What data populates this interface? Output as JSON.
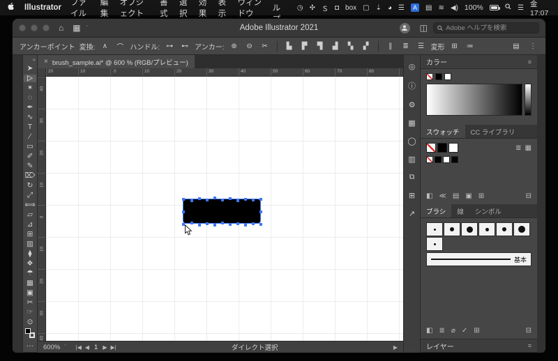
{
  "icons": {
    "close": "×",
    "chevron_small": "ˇ",
    "menu": "≡",
    "double_chevron": "»",
    "home": "⌂",
    "grid": "▦",
    "panel": "◫",
    "ellipsis": "…",
    "list_view": "≣",
    "grid_view": "▦",
    "play": "▶",
    "first": "|◀",
    "prev": "◀",
    "next": "▶",
    "last": "▶|",
    "control_center": "☰"
  },
  "menubar": {
    "app_name": "Illustrator",
    "menus": [
      "ファイル",
      "編集",
      "オブジェクト",
      "書式",
      "選択",
      "効果",
      "表示",
      "ウィンドウ",
      "ヘルプ"
    ],
    "status_icons": [
      "◷",
      "✣",
      "Ｓ",
      "◘",
      "box",
      "▢",
      "⇣",
      "◕",
      "☰"
    ],
    "input_badge": "A",
    "status_icons2": [
      "▤",
      "≋",
      "◀)"
    ],
    "battery_label": "100%",
    "clock": "金 17:07"
  },
  "titlebar": {
    "title": "Adobe Illustrator 2021",
    "search_placeholder": "Adobe ヘルプを検索"
  },
  "controlbar": {
    "anchor_point_label": "アンカーポイント",
    "convert_label": "変換:",
    "convert_icons": [
      "∧",
      "⌒"
    ],
    "handles_label": "ハンドル:",
    "handle_icons": [
      "⊶",
      "⊷"
    ],
    "anchors_label": "アンカー:",
    "anchor_icons": [
      "⊕",
      "⊖",
      "✂"
    ],
    "align_icons": [
      "▙",
      "▛",
      "▜",
      "▟",
      "▚",
      "▞"
    ],
    "dist_icons": [
      "∥",
      "≣",
      "☰"
    ],
    "transform_label": "変形",
    "extra_icons": [
      "⊞",
      "≔"
    ],
    "right_icons": [
      "▤",
      "⋮"
    ]
  },
  "doc": {
    "tab_title": "brush_sample.ai* @ 600 % (RGB/プレビュー)",
    "ruler_h": [
      "20",
      "10",
      "0",
      "10",
      "20",
      "30",
      "40",
      "50",
      "60",
      "70",
      "80"
    ],
    "ruler_v": [
      "40",
      "30",
      "20",
      "10",
      "0",
      "10",
      "20",
      "30",
      "40"
    ],
    "zoom": "600%",
    "page": "1",
    "status_tool": "ダイレクト選択"
  },
  "tools": [
    "➤",
    "▷",
    "✶",
    "◌",
    "✒",
    "∿",
    "T",
    "∕",
    "▭",
    "✐",
    "✎",
    "⌦",
    "↻",
    "⤢",
    "⟺",
    "▱",
    "⊿",
    "⊞",
    "▥",
    "⧫",
    "❖",
    "☂",
    "▦",
    "▣",
    "✂",
    "☞",
    "⊙"
  ],
  "icon_strip": [
    "◎",
    "ⓘ",
    "⚙",
    "▦",
    "◯",
    "▥",
    "⧉",
    "⊞",
    "↗"
  ],
  "panels": {
    "color": {
      "title": "カラー"
    },
    "swatches": {
      "tab1": "スウォッチ",
      "tab2": "CC ライブラリ",
      "footer_icons": [
        "◧",
        "≪",
        "▤",
        "▣",
        "⊞",
        "⊟"
      ]
    },
    "brushes": {
      "tab1": "ブラシ",
      "tab2": "線",
      "tab3": "シンボル",
      "basic_label": "基本",
      "dot_sizes": [
        3,
        6,
        9,
        5,
        6,
        10
      ],
      "dot_sizes_row2": [
        3
      ],
      "footer_icons": [
        "◧",
        "≣",
        "⌀",
        "✓",
        "⊞",
        "⊟"
      ]
    },
    "layers": {
      "title": "レイヤー"
    }
  },
  "colors": {
    "selection": "#3f76f6",
    "ramp_start": "#ffffff",
    "ramp_end": "#000000",
    "accent": "#2f6fde"
  }
}
